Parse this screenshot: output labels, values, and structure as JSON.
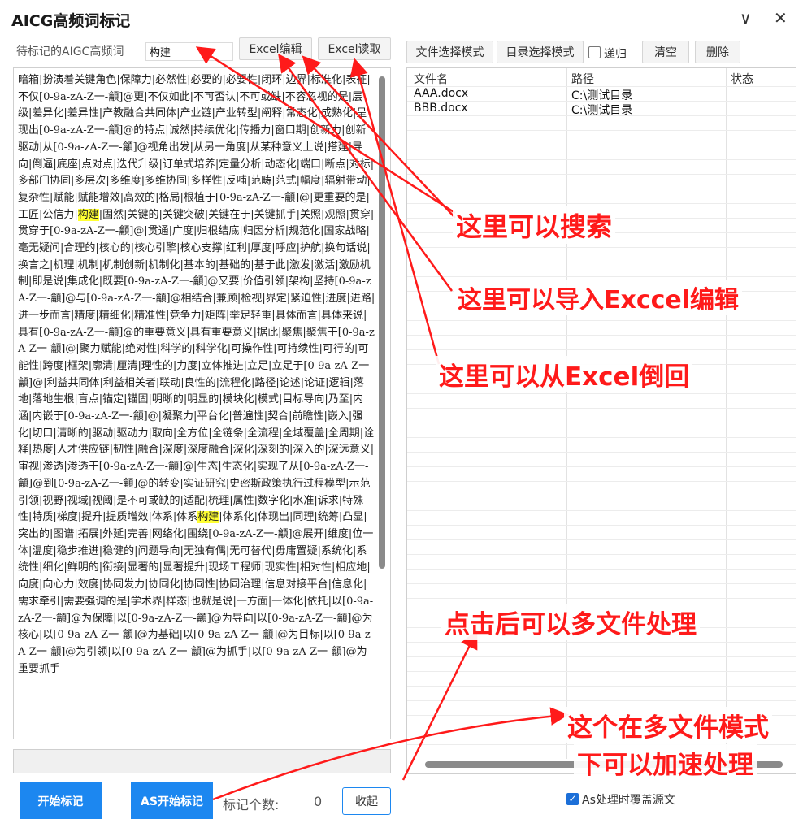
{
  "window": {
    "title": "AICG高频词标记",
    "minimize_glyph": "∨",
    "close_glyph": "✕"
  },
  "toolbar": {
    "keyword_label": "待标记的AIGC高频词",
    "keyword_value": "构建",
    "excel_edit": "Excel编辑",
    "excel_read": "Excel读取",
    "file_mode": "文件选择模式",
    "dir_mode": "目录选择模式",
    "recursive": "递归",
    "clear": "清空",
    "delete": "删除"
  },
  "word_list": {
    "segments": [
      {
        "t": "暗箱|扮演着关键角色|保障力|必然性|必要的|必要性|闭环|边界|标准化|表征|不仅[0-9a-zA-Z一-龥]@更|不仅如此|不可否认|不可或缺|不容忽视的是|层级|差异化|差异性|产教融合共同体|产业链|产业转型|阐释|常态化|成熟化|呈现出[0-9a-zA-Z一-龥]@的特点|诚然|持续优化|传播力|窗口期|创新力|创新驱动|从[0-9a-zA-Z一-龥]@视角出发|从另一角度|从某种意义上说|搭建|导向|倒逼|底座|点对点|迭代升级|订单式培养|定量分析|动态化|端口|断点|对标|多部门协同|多层次|多维度|多维协同|多样性|反哺|范畴|范式|幅度|辐射带动|复杂性|赋能|赋能增效|高效的|格局|根植于[0-9a-zA-Z一-龥]@|更重要的是|工匠|公信力|",
        "hl": false
      },
      {
        "t": "构建",
        "hl": true
      },
      {
        "t": "|固然|关键的|关键突破|关键在于|关键抓手|关照|观照|贯穿|贯穿于[0-9a-zA-Z一-龥]@|贯通|广度|归根结底|归因分析|规范化|国家战略|毫无疑问|合理的|核心的|核心引擎|核心支撑|红利|厚度|呼应|护航|换句话说|换言之|机理|机制|机制创新|机制化|基本的|基础的|基于此|激发|激活|激励机制|即是说|集成化|既要[0-9a-zA-Z一-龥]@又要|价值引领|架构|坚持[0-9a-zA-Z一-龥]@与[0-9a-zA-Z一-龥]@相结合|兼顾|检视|界定|紧迫性|进度|进路|进一步而言|精度|精细化|精准性|竞争力|矩阵|举足轻重|具体而言|具体来说|具有[0-9a-zA-Z一-龥]@的重要意义|具有重要意义|据此|聚焦|聚焦于[0-9a-zA-Z一-龥]@|聚力赋能|绝对性|科学的|科学化|可操作性|可持续性|可行的|可能性|跨度|框架|廓清|厘清|理性的|力度|立体推进|立足|立足于[0-9a-zA-Z一-龥]@|利益共同体|利益相关者|联动|良性的|流程化|路径|论述|论证|逻辑|落地|落地生根|盲点|锚定|锚固|明晰的|明显的|模块化|模式|目标导向|乃至|内涵|内嵌于[0-9a-zA-Z一-龥]@|凝聚力|平台化|普遍性|契合|前瞻性|嵌入|强化|切口|清晰的|驱动|驱动力|取向|全方位|全链条|全流程|全域覆盖|全周期|诠释|热度|人才供应链|韧性|融合|深度|深度融合|深化|深刻的|深入的|深远意义|审视|渗透|渗透于[0-9a-zA-Z一-龥]@|生态|生态化|实现了从[0-9a-zA-Z一-龥]@到[0-9a-zA-Z一-龥]@的转变|实证研究|史密斯政策执行过程模型|示范引领|视野|视域|视阈|是不可或缺的|适配|梳理|属性|数字化|水准|诉求|特殊性|特质|梯度|提升|提质增效|体系|体系",
        "hl": false
      },
      {
        "t": "构建",
        "hl": true
      },
      {
        "t": "|体系化|体现出|同理|统筹|凸显|突出的|图谱|拓展|外延|完善|网络化|围绕[0-9a-zA-Z一-龥]@展开|维度|位一体|温度|稳步推进|稳健的|问题导向|无独有偶|无可替代|毋庸置疑|系统化|系统性|细化|鲜明的|衔接|显著的|显著提升|现场工程师|现实性|相对性|相应地|向度|向心力|效度|协同发力|协同化|协同性|协同治理|信息对接平台|信息化|需求牵引|需要强调的是|学术界|样态|也就是说|一方面|一体化|依托|以[0-9a-zA-Z一-龥]@为保障|以[0-9a-zA-Z一-龥]@为导向|以[0-9a-zA-Z一-龥]@为核心|以[0-9a-zA-Z一-龥]@为基础|以[0-9a-zA-Z一-龥]@为目标|以[0-9a-zA-Z一-龥]@为引领|以[0-9a-zA-Z一-龥]@为抓手|以[0-9a-zA-Z一-龥]@为重要抓手",
        "hl": false
      }
    ]
  },
  "files": {
    "headers": [
      "文件名",
      "路径",
      "状态"
    ],
    "rows": [
      {
        "name": "AAA.docx",
        "path": "C:\\测试目录",
        "status": ""
      },
      {
        "name": "BBB.docx",
        "path": "C:\\测试目录",
        "status": ""
      }
    ]
  },
  "actions": {
    "start": "开始标记",
    "as_start": "AS开始标记",
    "count_label": "标记个数:",
    "count_value": "0",
    "collapse": "收起",
    "overwrite_label": "As处理时覆盖源文",
    "overwrite_checked": true
  },
  "annotations": {
    "search": "这里可以搜索",
    "import_excel": "这里可以导入Exccel编辑",
    "restore_excel": "这里可以从Excel倒回",
    "multi_file": "点击后可以多文件处理",
    "accelerate_1": "这个在多文件模式",
    "accelerate_2": "下可以加速处理",
    "color": "#ff1a1a"
  },
  "colors": {
    "primary_button": "#1c87f0",
    "highlight": "#ffff33",
    "annotation": "#ff1a1a"
  }
}
